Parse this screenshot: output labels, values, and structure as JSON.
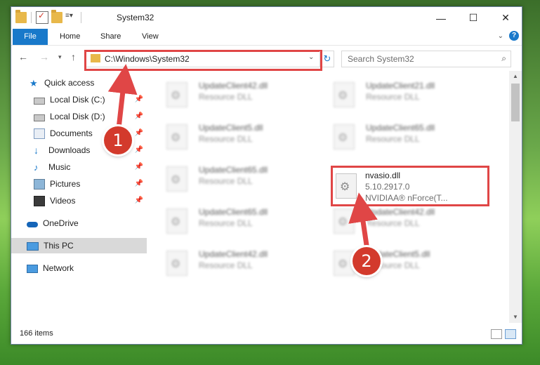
{
  "window": {
    "title": "System32"
  },
  "ribbon": {
    "tabs": [
      "File",
      "Home",
      "Share",
      "View"
    ]
  },
  "caption": {
    "minimize": "—",
    "maximize": "☐",
    "close": "✕"
  },
  "address": {
    "path": "C:\\Windows\\System32",
    "search_placeholder": "Search System32"
  },
  "nav": {
    "items": [
      {
        "label": "Quick access",
        "icon": "star-icon"
      },
      {
        "label": "Local Disk (C:)",
        "icon": "drive-icon",
        "pinned": true
      },
      {
        "label": "Local Disk (D:)",
        "icon": "drive-icon",
        "pinned": true
      },
      {
        "label": "Documents",
        "icon": "documents-icon",
        "pinned": true
      },
      {
        "label": "Downloads",
        "icon": "downloads-icon",
        "pinned": true
      },
      {
        "label": "Music",
        "icon": "music-icon",
        "pinned": true
      },
      {
        "label": "Pictures",
        "icon": "pictures-icon",
        "pinned": true
      },
      {
        "label": "Videos",
        "icon": "videos-icon",
        "pinned": true
      },
      {
        "label": "OneDrive",
        "icon": "cloud-icon"
      },
      {
        "label": "This PC",
        "icon": "computer-icon",
        "selected": true
      },
      {
        "label": "Network",
        "icon": "network-icon"
      }
    ]
  },
  "files": {
    "left": [
      {
        "name": "UpdateClient42.dll",
        "type": "Resource DLL"
      },
      {
        "name": "UpdateClient5.dll",
        "type": "Resource DLL"
      },
      {
        "name": "UpdateClient65.dll",
        "type": "Resource DLL"
      },
      {
        "name": "UpdateClient65.dll",
        "type": "Resource DLL"
      },
      {
        "name": "UpdateClient42.dll",
        "type": "Resource DLL"
      }
    ],
    "right": [
      {
        "name": "UpdateClient21.dll",
        "type": "Resource DLL"
      },
      {
        "name": "UpdateClient65.dll",
        "type": "Resource DLL"
      },
      {
        "name": "UpdateClient42.dll",
        "type": "Resource DLL"
      },
      {
        "name": "UpdateClient5.dll",
        "type": "Resource DLL"
      }
    ],
    "highlighted": {
      "name": "nvasio.dll",
      "version": "5.10.2917.0",
      "company": "NVIDIAA® nForce(T..."
    }
  },
  "status": {
    "count": "166 items"
  },
  "callouts": [
    "1",
    "2"
  ],
  "colors": {
    "accent": "#1979ca",
    "highlight": "#e04646",
    "callout": "#d33a2c"
  }
}
